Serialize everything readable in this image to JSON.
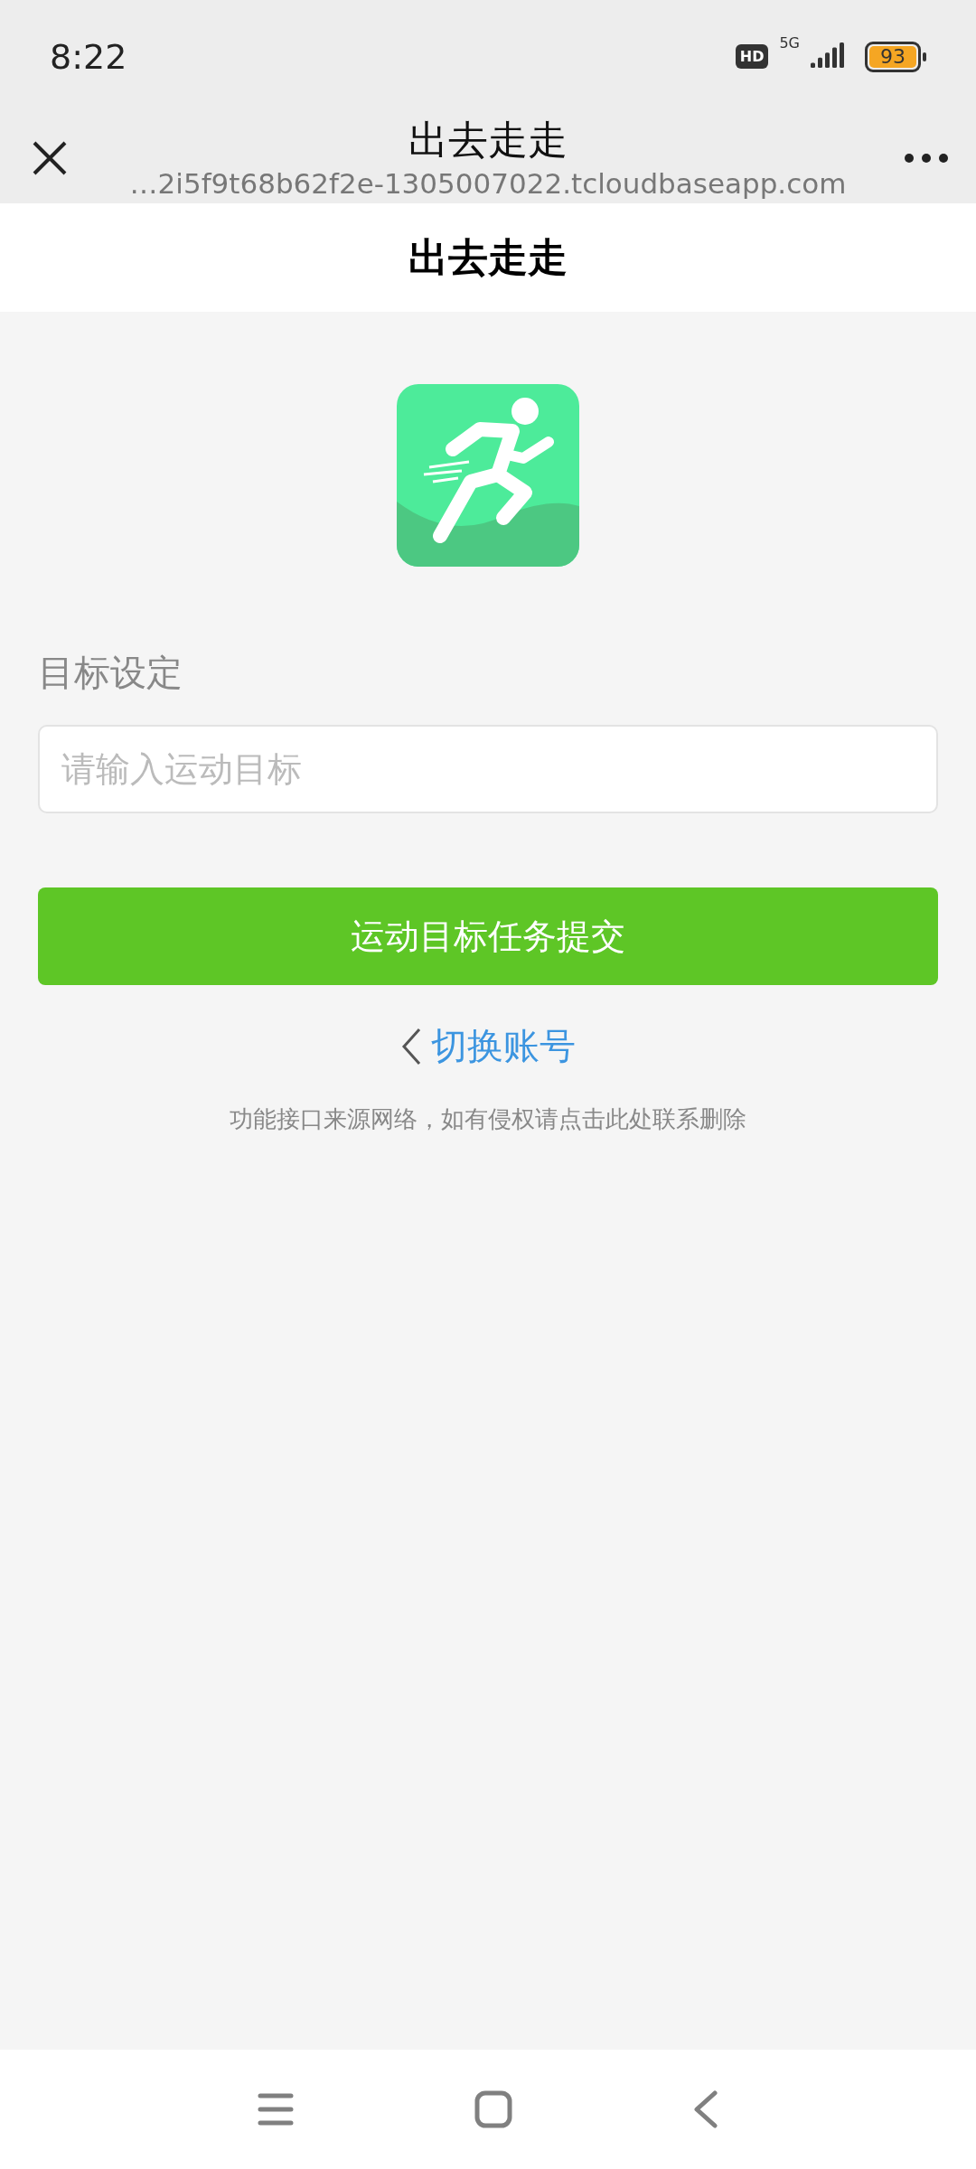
{
  "status_bar": {
    "time": "8:22",
    "hd_badge": "HD",
    "network": "5G",
    "battery": "93"
  },
  "browser_bar": {
    "title": "出去走走",
    "url": "…2i5f9t68b62f2e-1305007022.tcloudbaseapp.com"
  },
  "page_title": "出去走走",
  "form": {
    "label": "目标设定",
    "input": {
      "placeholder": "请输入运动目标"
    },
    "submit": "运动目标任务提交"
  },
  "switch_account": "切换账号",
  "notice": "功能接口来源网络，如有侵权请点击此处联系删除"
}
